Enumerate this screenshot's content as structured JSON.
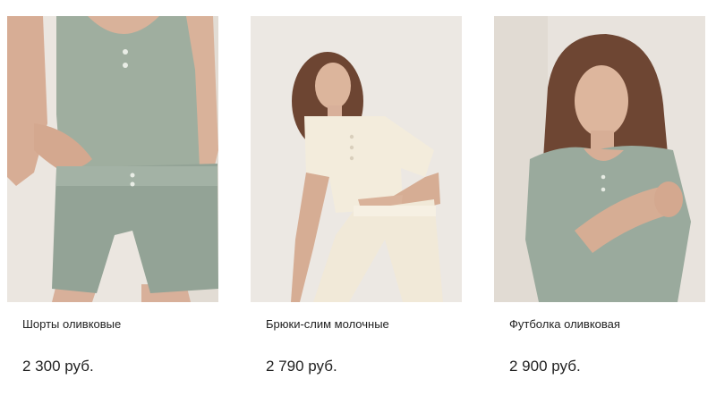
{
  "products": [
    {
      "name": "Шорты оливковые",
      "price": "2 300 руб.",
      "image_subject": "model-wearing-sage-shorts-and-tank"
    },
    {
      "name": "Брюки-слим молочные",
      "price": "2 790 руб.",
      "image_subject": "model-wearing-cream-tee-and-slim-pants"
    },
    {
      "name": "Футболка оливковая",
      "price": "2 900 руб.",
      "image_subject": "model-wearing-sage-tshirt"
    }
  ],
  "colors": {
    "sage": "#9aaa9d",
    "sage_dark": "#7f9084",
    "cream": "#f1e9d8",
    "backdrop": "#ece7e1",
    "skin": "#d9b29a",
    "hair": "#6b4430",
    "text": "#222222"
  }
}
